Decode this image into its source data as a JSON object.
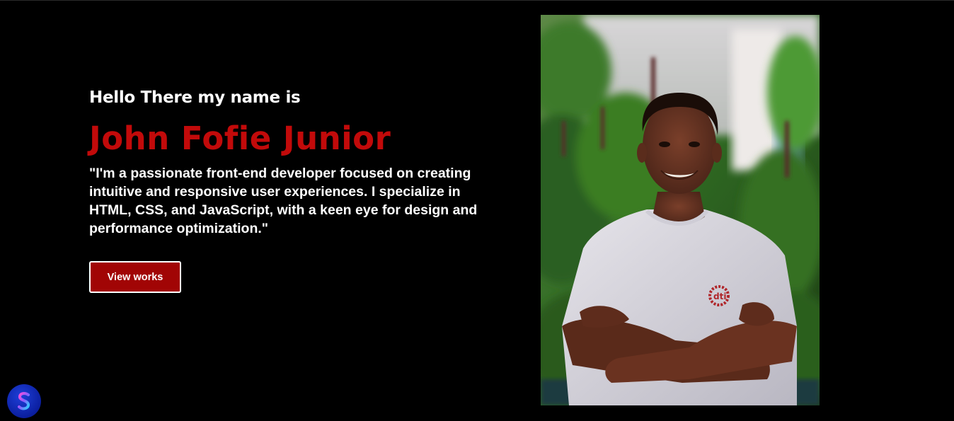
{
  "hero": {
    "greeting": "Hello There my name is",
    "name": "John Fofie Junior",
    "bio": "\"I'm a passionate front-end developer focused on creating intuitive and responsive user experiences. I specialize in HTML, CSS, and JavaScript, with a keen eye for design and performance optimization.\"",
    "cta_label": "View works"
  },
  "photo": {
    "subject": "portrait-photo",
    "shirt_logo": "dti"
  },
  "floating_button": {
    "icon": "s-logo-icon"
  },
  "colors": {
    "background": "#000000",
    "name_accent": "#c20a0a",
    "button_fill": "#a10505",
    "button_border": "#ffffff",
    "fab": "#0b1fa0"
  }
}
